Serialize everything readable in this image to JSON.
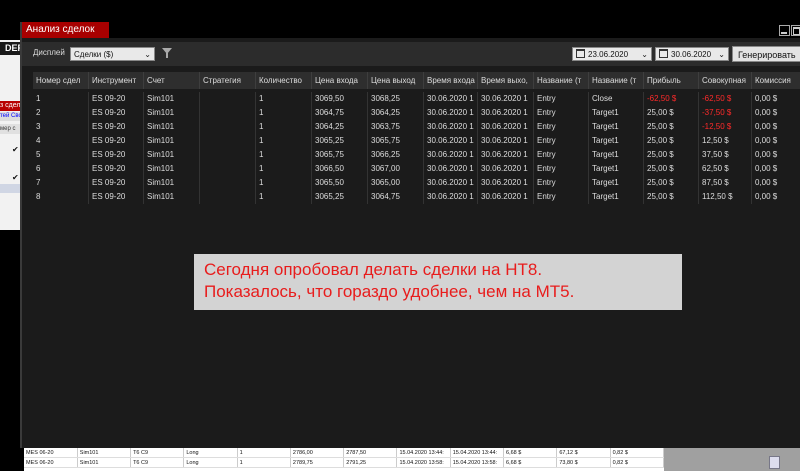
{
  "background": {
    "logo": "DER",
    "tab_label": "з сделк",
    "tab2_label": "тей Сво",
    "col_label": "мер с",
    "bottom_rows": [
      [
        "MES 06-20",
        "Sim101",
        "T6 C9",
        "Long",
        "1",
        "2786,00",
        "2787,50",
        "15.04.2020 13:44:",
        "15.04.2020 13:44:",
        "6,68 $",
        "67,12 $",
        "0,82 $"
      ],
      [
        "MES 06-20",
        "Sim101",
        "T6 C9",
        "Long",
        "1",
        "2789,75",
        "2791,25",
        "15.04.2020 13:58:",
        "15.04.2020 13:58:",
        "6,68 $",
        "73,80 $",
        "0,82 $"
      ]
    ]
  },
  "window": {
    "title": "Анализ сделок",
    "toolbar": {
      "display_label": "Дисплей",
      "display_value": "Сделки ($)",
      "date_from": "23.06.2020",
      "date_to": "30.06.2020",
      "generate_label": "Генерировать"
    },
    "columns": [
      "Номер сдел",
      "Инструмент",
      "Счет",
      "Стратегия",
      "Количество",
      "Цена входа",
      "Цена выход",
      "Время входа",
      "Время выхо,",
      "Название (т",
      "Название (т",
      "Прибыль",
      "Совокупная",
      "Комиссия"
    ],
    "rows": [
      [
        "1",
        "ES 09-20",
        "Sim101",
        "",
        "1",
        "3069,50",
        "3068,25",
        "30.06.2020 1",
        "30.06.2020 1",
        "Entry",
        "Close",
        "-62,50 $",
        "-62,50 $",
        "0,00 $"
      ],
      [
        "2",
        "ES 09-20",
        "Sim101",
        "",
        "1",
        "3064,75",
        "3064,25",
        "30.06.2020 1",
        "30.06.2020 1",
        "Entry",
        "Target1",
        "25,00 $",
        "-37,50 $",
        "0,00 $"
      ],
      [
        "3",
        "ES 09-20",
        "Sim101",
        "",
        "1",
        "3064,25",
        "3063,75",
        "30.06.2020 1",
        "30.06.2020 1",
        "Entry",
        "Target1",
        "25,00 $",
        "-12,50 $",
        "0,00 $"
      ],
      [
        "4",
        "ES 09-20",
        "Sim101",
        "",
        "1",
        "3065,25",
        "3065,75",
        "30.06.2020 1",
        "30.06.2020 1",
        "Entry",
        "Target1",
        "25,00 $",
        "12,50 $",
        "0,00 $"
      ],
      [
        "5",
        "ES 09-20",
        "Sim101",
        "",
        "1",
        "3065,75",
        "3066,25",
        "30.06.2020 1",
        "30.06.2020 1",
        "Entry",
        "Target1",
        "25,00 $",
        "37,50 $",
        "0,00 $"
      ],
      [
        "6",
        "ES 09-20",
        "Sim101",
        "",
        "1",
        "3066,50",
        "3067,00",
        "30.06.2020 1",
        "30.06.2020 1",
        "Entry",
        "Target1",
        "25,00 $",
        "62,50 $",
        "0,00 $"
      ],
      [
        "7",
        "ES 09-20",
        "Sim101",
        "",
        "1",
        "3065,50",
        "3065,00",
        "30.06.2020 1",
        "30.06.2020 1",
        "Entry",
        "Target1",
        "25,00 $",
        "87,50 $",
        "0,00 $"
      ],
      [
        "8",
        "ES 09-20",
        "Sim101",
        "",
        "1",
        "3065,25",
        "3064,75",
        "30.06.2020 1",
        "30.06.2020 1",
        "Entry",
        "Target1",
        "25,00 $",
        "112,50 $",
        "0,00 $"
      ]
    ]
  },
  "annotation": {
    "line1": "Сегодня опробовал делать сделки на НТ8.",
    "line2": "Показалось, что гораздо удобнее, чем на МТ5."
  },
  "colors": {
    "title_bar": "#a80000",
    "negative": "#ff2a2a",
    "annotation_text": "#e81c1c"
  }
}
